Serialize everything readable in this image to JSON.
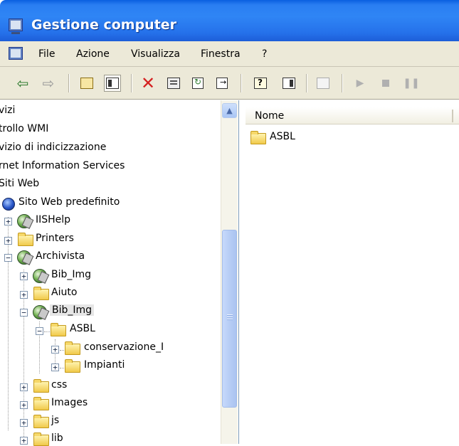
{
  "window": {
    "title": "Gestione computer"
  },
  "menu": {
    "items": [
      "File",
      "Azione",
      "Visualizza",
      "Finestra",
      "?"
    ]
  },
  "toolbar": {
    "icons": [
      "back-icon",
      "forward-icon",
      "up-folder-icon",
      "show-hide-tree-icon",
      "delete-icon",
      "properties-icon",
      "refresh-icon",
      "export-list-icon",
      "help-icon",
      "show-hide-action-pane-icon",
      "connect-computer-icon",
      "play-icon",
      "stop-icon",
      "pause-icon"
    ]
  },
  "tree": {
    "items": [
      {
        "label": "vizi"
      },
      {
        "label": "trollo WMI"
      },
      {
        "label": "vizio di indicizzazione"
      },
      {
        "label": "rnet Information Services"
      },
      {
        "label": "Siti Web"
      },
      {
        "label": "Sito Web predefinito"
      },
      {
        "label": "IISHelp"
      },
      {
        "label": "Printers"
      },
      {
        "label": "Archivista"
      },
      {
        "label": "Bib_Img"
      },
      {
        "label": "Aiuto"
      },
      {
        "label": "Bib_Img"
      },
      {
        "label": "ASBL"
      },
      {
        "label": "conservazione_I"
      },
      {
        "label": "Impianti"
      },
      {
        "label": "css"
      },
      {
        "label": "Images"
      },
      {
        "label": "js"
      },
      {
        "label": "lib"
      }
    ]
  },
  "list": {
    "column": "Nome",
    "rows": [
      {
        "label": "ASBL"
      }
    ]
  }
}
